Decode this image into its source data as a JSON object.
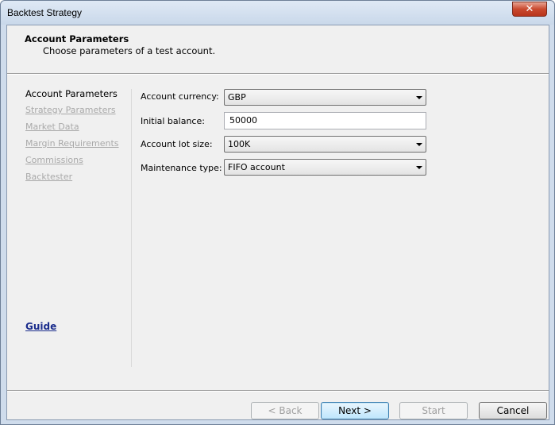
{
  "window": {
    "title": "Backtest Strategy",
    "close_glyph": "✕"
  },
  "header": {
    "title": "Account Parameters",
    "subtitle": "Choose parameters of a test account."
  },
  "nav": {
    "items": [
      {
        "label": "Account Parameters",
        "active": true
      },
      {
        "label": "Strategy Parameters",
        "active": false
      },
      {
        "label": "Market Data",
        "active": false
      },
      {
        "label": "Margin Requirements",
        "active": false
      },
      {
        "label": "Commissions",
        "active": false
      },
      {
        "label": "Backtester",
        "active": false
      }
    ],
    "guide_label": "Guide"
  },
  "form": {
    "currency_label": "Account currency:",
    "currency_value": "GBP",
    "balance_label": "Initial balance:",
    "balance_value": "50000",
    "lot_label": "Account lot size:",
    "lot_value": "100K",
    "maintenance_label": "Maintenance type:",
    "maintenance_value": "FIFO account"
  },
  "footer": {
    "back_label": "< Back",
    "next_label": "Next >",
    "start_label": "Start",
    "cancel_label": "Cancel"
  },
  "colors": {
    "link_active": "#1a2c8c",
    "link_disabled": "#a9a9a9",
    "close_button": "#c9492e"
  }
}
